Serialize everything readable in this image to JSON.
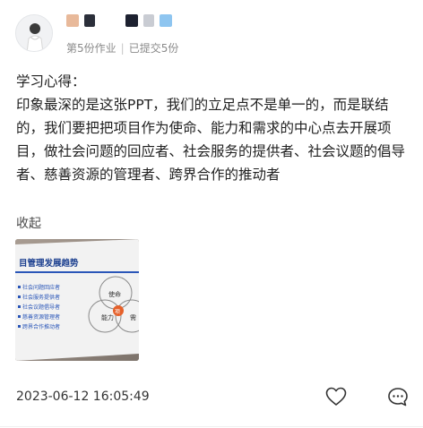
{
  "post": {
    "meta_assignment": "第5份作业",
    "meta_separator": "|",
    "meta_submitted": "已提交5份",
    "content_title": "学习心得：",
    "content_body": "印象最深的是这张PPT，我们的立足点不是单一的，而是联结的，我们要把把项目作为使命、能力和需求的中心点去开展项目，做社会问题的回应者、社会服务的提供者、社会议题的倡导者、慈善资源的管理者、跨界合作的推动者",
    "collapse_label": "收起",
    "timestamp": "2023-06-12 16:05:49"
  },
  "slide_image": {
    "heading": "目管理发展趋势",
    "circle_labels": [
      "使命",
      "能力",
      "需"
    ],
    "center_label": "项",
    "bullets": [
      "社会问题回应者",
      "社会服务提供者",
      "社会议题倡导者",
      "慈善资源管理者",
      "跨界合作推动者"
    ]
  },
  "icons": {
    "like": "heart-outline-icon",
    "comment": "comment-bubble-icon"
  },
  "colors": {
    "text": "#1f1f1f",
    "meta": "#8a8a8a",
    "slide_heading": "#1b3f8f",
    "slide_accent": "#e5602a"
  }
}
